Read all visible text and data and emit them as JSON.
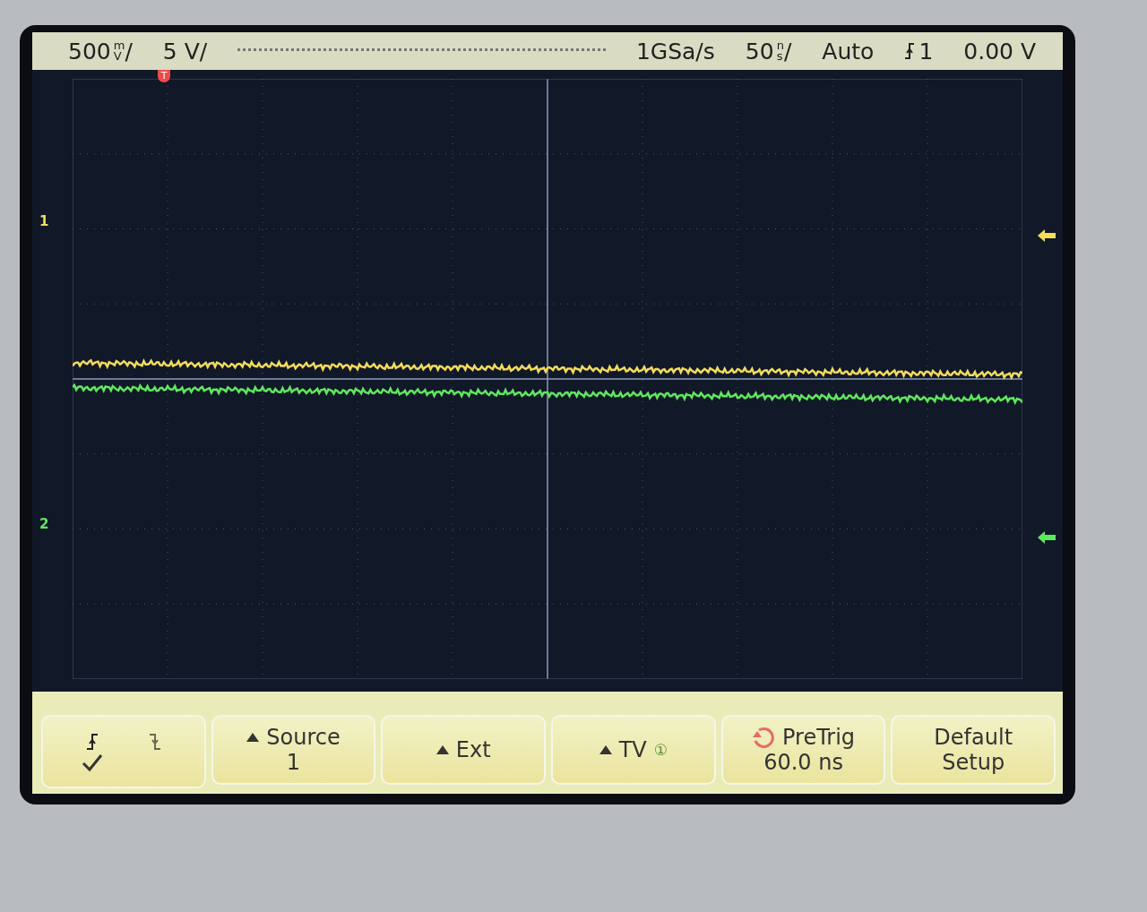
{
  "status_bar": [
    {
      "kind": "scale",
      "value": "500",
      "prefix": "m",
      "unit": "V",
      "suffix": "/"
    },
    {
      "kind": "text",
      "text": "5 V/"
    },
    {
      "kind": "memory"
    },
    {
      "kind": "text",
      "text": "1GSa/s"
    },
    {
      "kind": "scale",
      "value": "50",
      "prefix": "n",
      "unit": "s",
      "suffix": "/"
    },
    {
      "kind": "text",
      "text": "Auto"
    },
    {
      "kind": "trigger",
      "text": "1"
    },
    {
      "kind": "text",
      "text": "0.00 V"
    }
  ],
  "trigger_marker": {
    "label": "T"
  },
  "channels": [
    {
      "label": "1",
      "color": "#f2dc5a"
    },
    {
      "label": "2",
      "color": "#5ee85e"
    }
  ],
  "softkeys": [
    {
      "kind": "edge",
      "options": [
        {
          "kind": "rising",
          "selected": true
        },
        {
          "kind": "falling",
          "selected": false
        }
      ]
    },
    {
      "kind": "menu",
      "lines": [
        "Source",
        "1"
      ]
    },
    {
      "kind": "menu",
      "lines": [
        "Ext"
      ]
    },
    {
      "kind": "menu",
      "lines": [
        "TV"
      ],
      "badge": "①"
    },
    {
      "kind": "knob",
      "lines": [
        "PreTrig",
        "60.0 ns"
      ]
    },
    {
      "kind": "plain",
      "lines": [
        "Default",
        "Setup"
      ]
    }
  ]
}
